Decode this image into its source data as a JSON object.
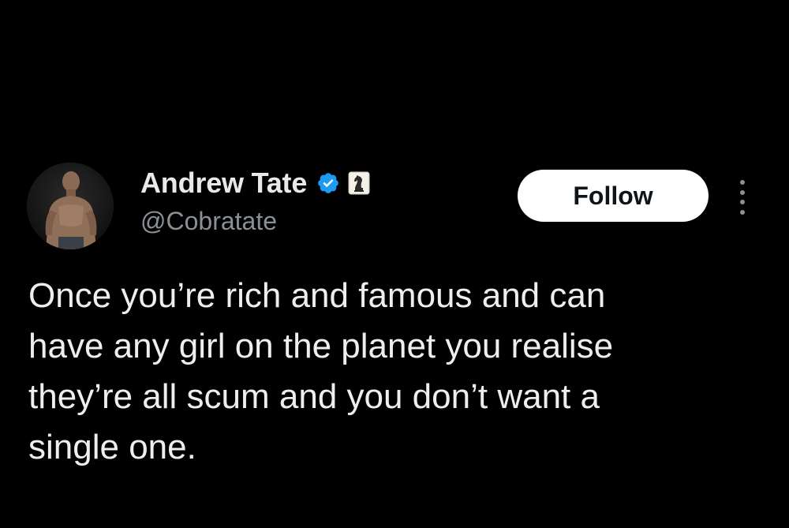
{
  "author": {
    "display_name": "Andrew Tate",
    "handle": "@Cobratate",
    "verified": true,
    "verified_color": "#1d9bf0",
    "affiliate_badge_icon": "chess-knight-badge-icon"
  },
  "actions": {
    "follow_label": "Follow",
    "more_icon": "more-vertical-icon"
  },
  "tweet": {
    "lines": [
      "Once you’re rich and famous and can",
      "have any girl on the planet you realise",
      "they’re all scum and you don’t want a",
      "single one."
    ]
  },
  "theme": {
    "background": "#000000",
    "text": "#e7e9ea",
    "secondary_text": "#8b9096",
    "follow_button_bg": "#ffffff",
    "follow_button_text": "#0f1419"
  }
}
